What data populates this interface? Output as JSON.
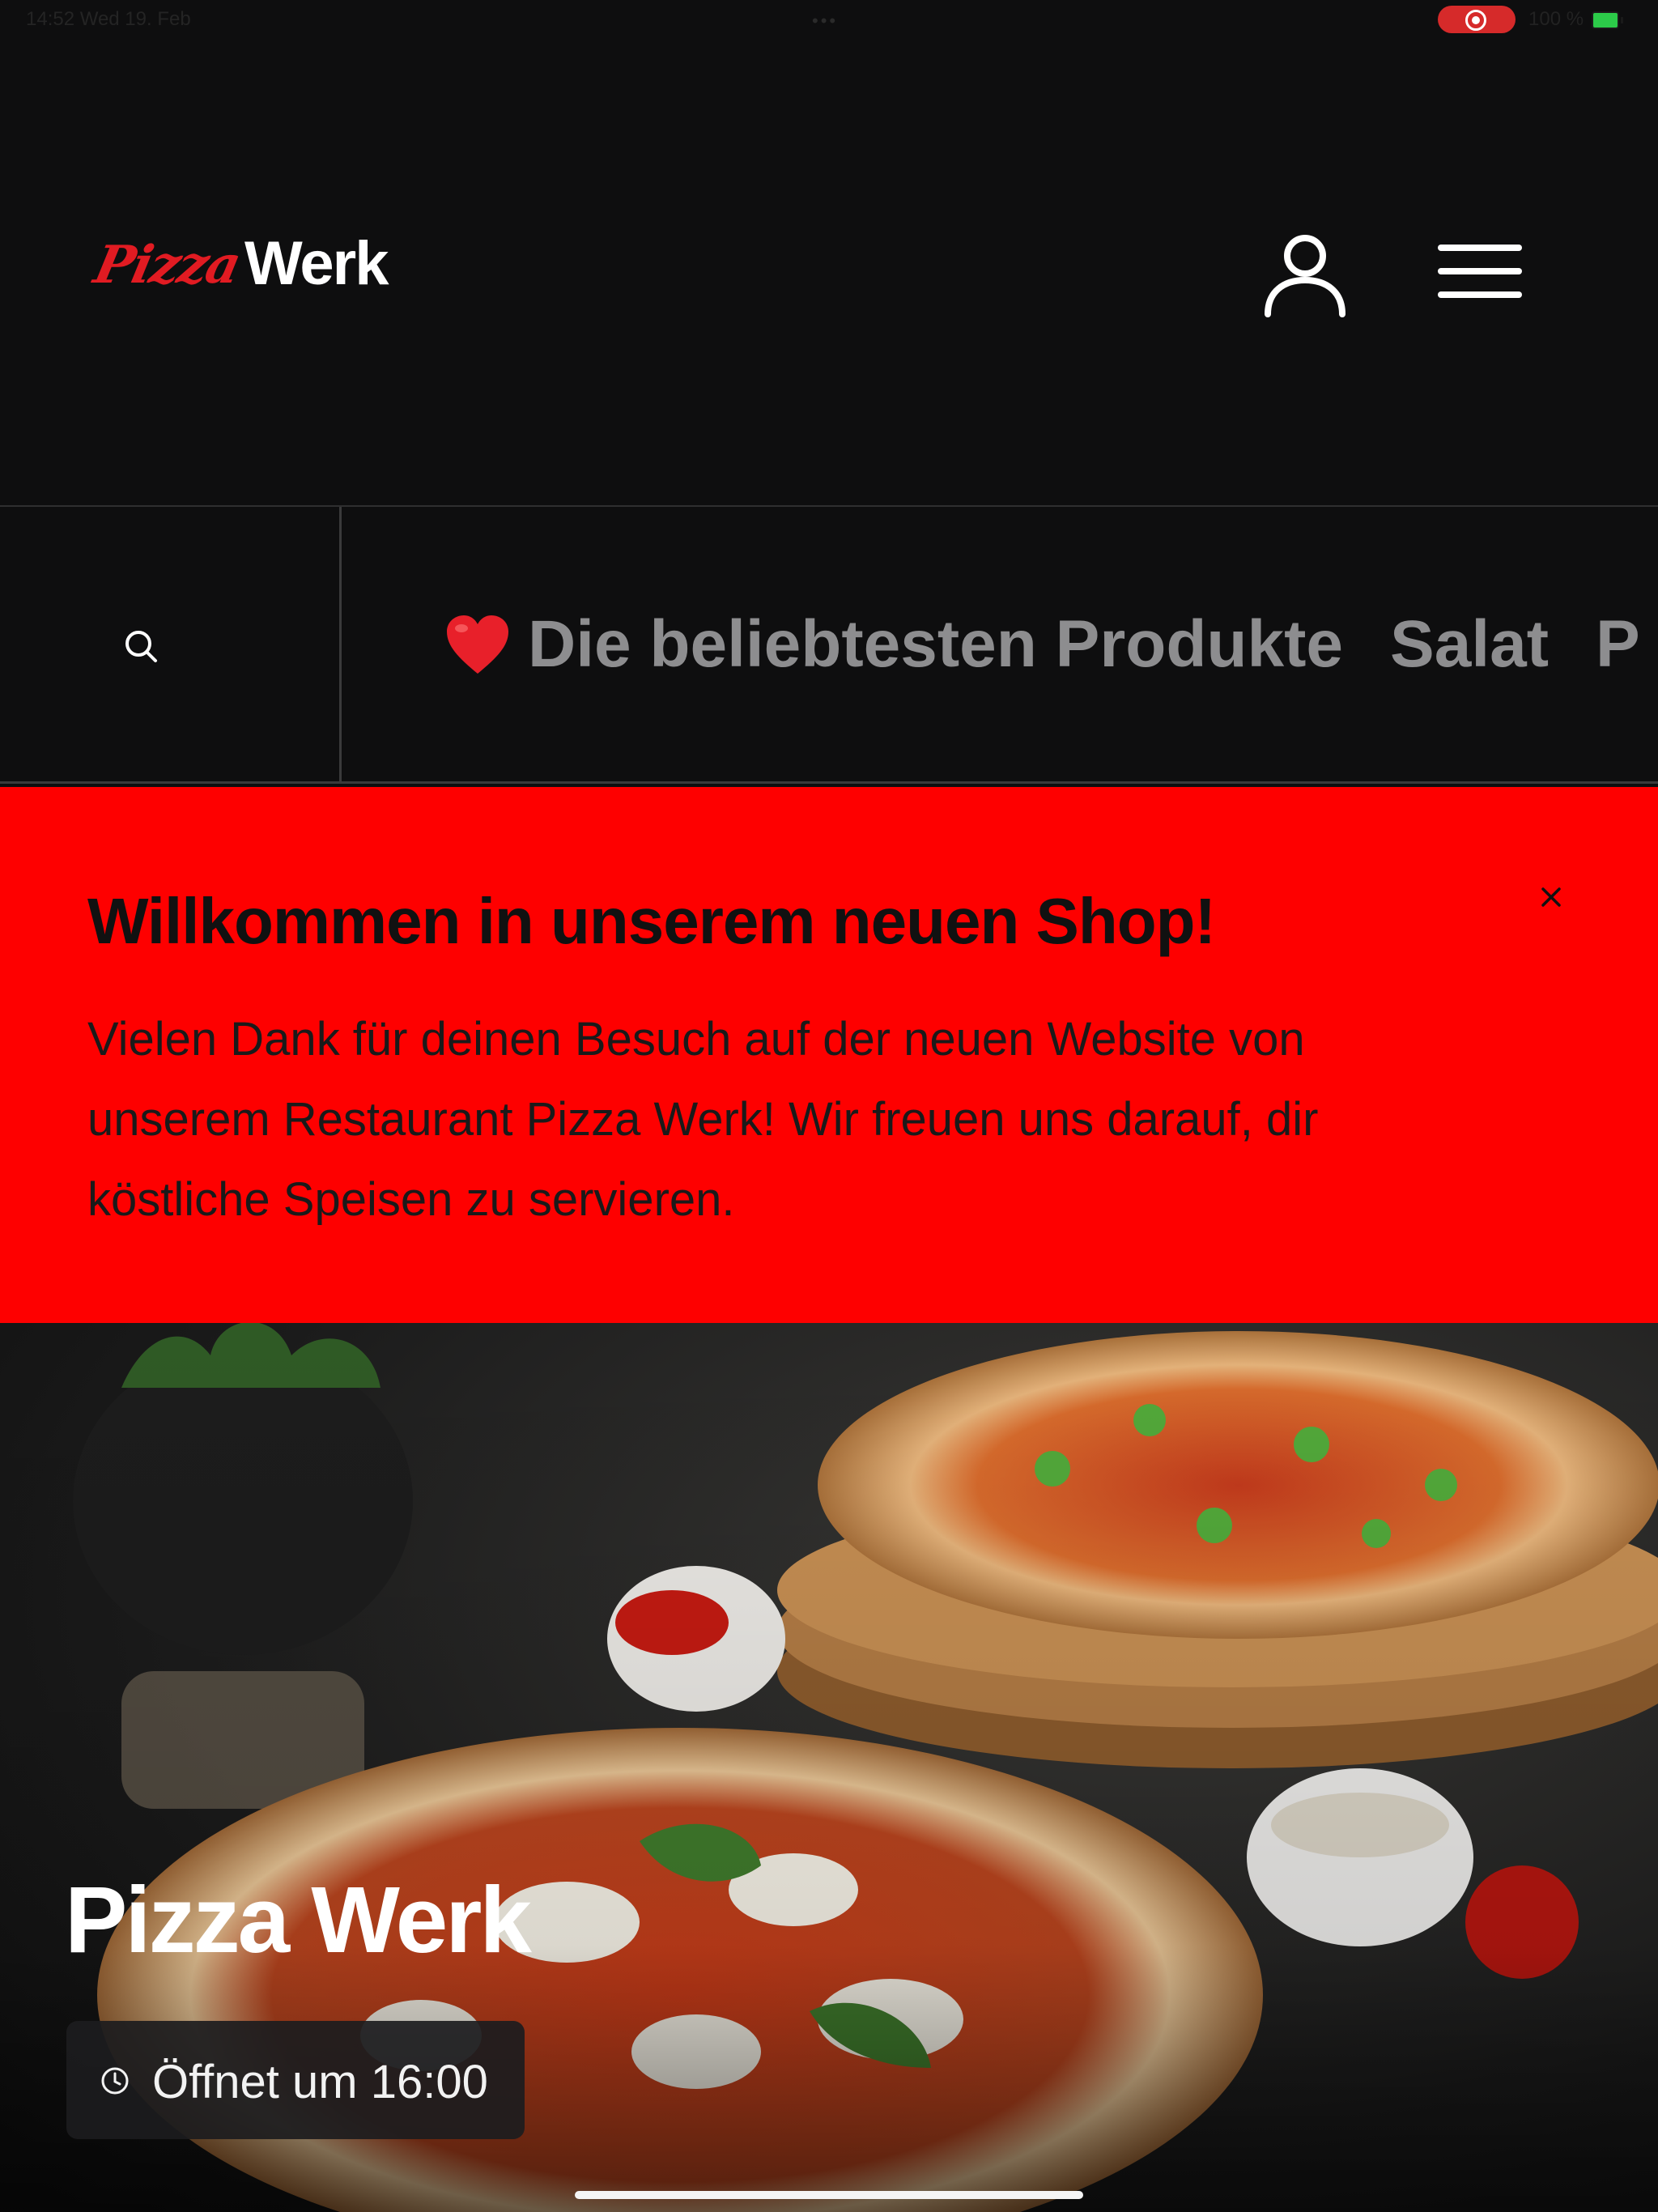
{
  "status_bar": {
    "time": "14:52  Wed 19. Feb",
    "battery": "100 %",
    "dots": "•••"
  },
  "header": {
    "logo_script": "Pizza",
    "logo_word": "Werk"
  },
  "categories": [
    {
      "label": "Die beliebtesten Produkte",
      "emoji": "❤️"
    },
    {
      "label": "Salat"
    },
    {
      "label": "P"
    }
  ],
  "banner": {
    "title": "Willkommen in unserem neuen Shop!",
    "body": "Vielen Dank für deinen Besuch auf der neuen Website von unserem Restaurant Pizza Werk! Wir freuen uns darauf, dir köstliche Speisen zu servieren."
  },
  "hero": {
    "title": "Pizza Werk",
    "open_status": "Öffnet um 16:00"
  },
  "colors": {
    "background": "#0e0e0f",
    "banner": "#fe0000",
    "category_text": "#8d8d8f",
    "brand_red": "#e11b22"
  }
}
